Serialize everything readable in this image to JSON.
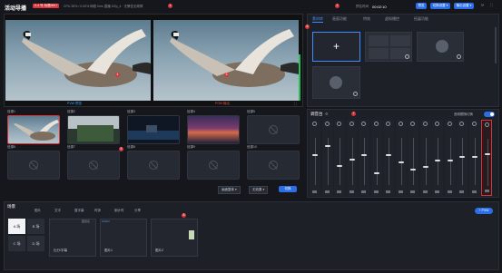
{
  "app": {
    "title": "活动导播",
    "badge": "0-4 号-标题0817",
    "status": "CPU 25% / 0.00%  网络 0ms  直播 0/2p_4  · 无警告无故障",
    "num1": "1"
  },
  "clock": {
    "label": "预估时间",
    "time": "00:02:10"
  },
  "header": {
    "num2": "2",
    "btn_a": "预览",
    "btn_b": "切换设置 ▾",
    "btn_c": "输出设置 ▾"
  },
  "preview": {
    "left_label": "PVW 预览",
    "right_label": "PGM 输出",
    "num_left": "4",
    "num_right": "3"
  },
  "sources": {
    "items": [
      {
        "name": "信源1"
      },
      {
        "name": "信源2"
      },
      {
        "name": "信源3"
      },
      {
        "name": "信源4"
      },
      {
        "name": "信源5"
      },
      {
        "name": "信源6"
      },
      {
        "name": "信源7"
      },
      {
        "name": "信源8"
      },
      {
        "name": "信源9"
      },
      {
        "name": "信源10"
      }
    ],
    "num5": "5",
    "select1": "画面整体 ▾",
    "select2": "无效果 ▾",
    "apply": "切换"
  },
  "right_tabs": {
    "items": [
      "素材库",
      "画面功能",
      "特效",
      "虚拟播控",
      "拓展功能"
    ],
    "num6": "6"
  },
  "mixer": {
    "title": "调音台",
    "num7": "7",
    "sync_label": "音频跟随切换",
    "scale": [
      "0dB",
      "-10",
      "-20",
      "-30",
      "-40"
    ]
  },
  "layers": {
    "title": "场景",
    "add_button": "+ PVW",
    "tools": [
      "图片",
      "文字",
      "直字幕",
      "时钟",
      "倒计时",
      "分享"
    ],
    "num8": "8",
    "scenes": [
      "A 场",
      "B 场",
      "C 场",
      "D 场"
    ],
    "items": [
      {
        "name": "比分/字幕",
        "header": "图层名"
      },
      {
        "name": "图片1",
        "header": "LOGO"
      },
      {
        "name": "图片2",
        "header": ""
      }
    ]
  }
}
